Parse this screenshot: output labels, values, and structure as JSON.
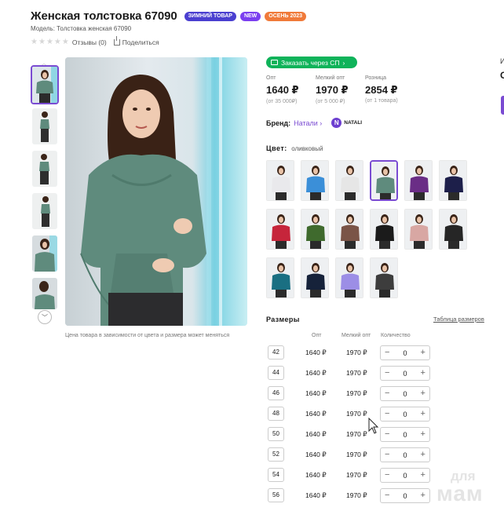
{
  "product": {
    "title": "Женская толстовка 67090",
    "badges": [
      {
        "label": "ЗИМНИЙ ТОВАР",
        "color": "#4a3fd0"
      },
      {
        "label": "NEW",
        "color": "#7b3ff0"
      },
      {
        "label": "ОСЕНЬ 2023",
        "color": "#f07a3a"
      }
    ],
    "model": "Модель: Толстовка женская 67090",
    "reviews": "Отзывы (0)",
    "share": "Поделиться",
    "photo_note": "Цена товара в зависимости от цвета и размера может меняться"
  },
  "order_button": "Заказать через СП",
  "prices": [
    {
      "label": "Опт",
      "value": "1640 ₽",
      "sub": "(от 35 000₽)"
    },
    {
      "label": "Мелкий опт",
      "value": "1970 ₽",
      "sub": "(от 5 000 ₽)"
    },
    {
      "label": "Розница",
      "value": "2854 ₽",
      "sub": "(от 1 товара)"
    }
  ],
  "brand": {
    "label": "Бренд:",
    "name": "Натали",
    "logo_text": "NATALI"
  },
  "color": {
    "label": "Цвет:",
    "value": "оливковый"
  },
  "swatch_colors": [
    "#e9e9ec",
    "#3b8fd8",
    "#e6e6e6",
    "#5f8b7d",
    "#6a2d86",
    "#1d1f4a",
    "#c6253b",
    "#3f6a2d",
    "#7a5447",
    "#1b1b1b",
    "#d8a7a3",
    "#262626",
    "#1a6f82",
    "#16223a",
    "#9c8ee6",
    "#3d3d3d"
  ],
  "sizes": {
    "heading": "Размеры",
    "table_link": "Таблица размеров",
    "col_opt": "Опт",
    "col_small": "Мелкий опт",
    "col_qty": "Количество",
    "rows": [
      {
        "size": "42",
        "opt": "1640 ₽",
        "small": "1970 ₽",
        "qty": "0"
      },
      {
        "size": "44",
        "opt": "1640 ₽",
        "small": "1970 ₽",
        "qty": "0"
      },
      {
        "size": "46",
        "opt": "1640 ₽",
        "small": "1970 ₽",
        "qty": "0"
      },
      {
        "size": "48",
        "opt": "1640 ₽",
        "small": "1970 ₽",
        "qty": "0"
      },
      {
        "size": "50",
        "opt": "1640 ₽",
        "small": "1970 ₽",
        "qty": "0"
      },
      {
        "size": "52",
        "opt": "1640 ₽",
        "small": "1970 ₽",
        "qty": "0"
      },
      {
        "size": "54",
        "opt": "1640 ₽",
        "small": "1970 ₽",
        "qty": "0"
      },
      {
        "size": "56",
        "opt": "1640 ₽",
        "small": "1970 ₽",
        "qty": "0"
      }
    ]
  },
  "watermark": {
    "small": "для",
    "big": "мам"
  },
  "edge": {
    "letter": "И",
    "big": "С"
  },
  "qty_minus": "−",
  "qty_plus": "+"
}
